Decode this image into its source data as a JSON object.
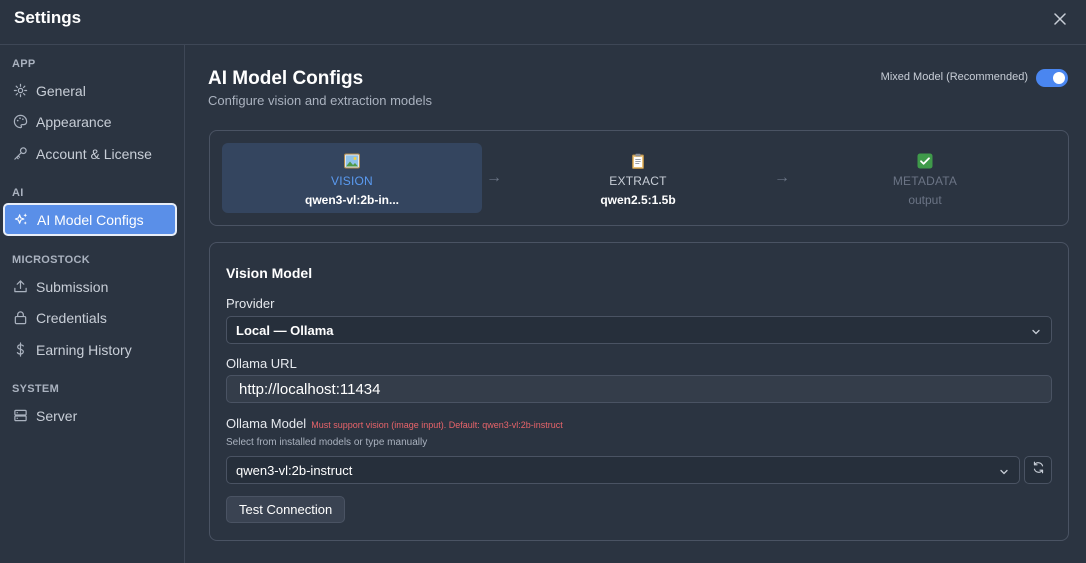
{
  "window": {
    "title": "Settings"
  },
  "sidebar": {
    "sections": [
      {
        "label": "APP",
        "items": [
          {
            "label": "General",
            "icon": "gear-icon"
          },
          {
            "label": "Appearance",
            "icon": "palette-icon"
          },
          {
            "label": "Account & License",
            "icon": "key-icon"
          }
        ]
      },
      {
        "label": "AI",
        "items": [
          {
            "label": "AI Model Configs",
            "icon": "sparkles-icon",
            "active": true
          }
        ]
      },
      {
        "label": "MICROSTOCK",
        "items": [
          {
            "label": "Submission",
            "icon": "upload-icon"
          },
          {
            "label": "Credentials",
            "icon": "lock-icon"
          },
          {
            "label": "Earning History",
            "icon": "dollar-icon"
          }
        ]
      },
      {
        "label": "SYSTEM",
        "items": [
          {
            "label": "Server",
            "icon": "server-icon"
          }
        ]
      }
    ]
  },
  "header": {
    "title": "AI Model Configs",
    "subtitle": "Configure vision and extraction models",
    "mixed_model_label": "Mixed Model (Recommended)",
    "mixed_model_enabled": true
  },
  "pipeline": {
    "steps": [
      {
        "label": "VISION",
        "model": "qwen3-vl:2b-in...",
        "icon": "image-icon",
        "state": "active"
      },
      {
        "label": "EXTRACT",
        "model": "qwen2.5:1.5b",
        "icon": "clipboard-icon",
        "state": "normal"
      },
      {
        "label": "METADATA",
        "model": "output",
        "icon": "check-icon",
        "state": "disabled"
      }
    ],
    "arrow": "→"
  },
  "vision_model": {
    "title": "Vision Model",
    "provider_label": "Provider",
    "provider_value": "Local — Ollama",
    "url_label": "Ollama URL",
    "url_value": "http://localhost:11434",
    "model_label": "Ollama Model",
    "model_warning": "Must support vision (image input). Default: qwen3-vl:2b-instruct",
    "model_hint": "Select from installed models or type manually",
    "model_value": "qwen3-vl:2b-instruct",
    "test_button": "Test Connection"
  },
  "colors": {
    "accent": "#4a86f0",
    "active_nav": "#5a8fe8",
    "warning": "#e8646a",
    "background": "#2b3441"
  }
}
